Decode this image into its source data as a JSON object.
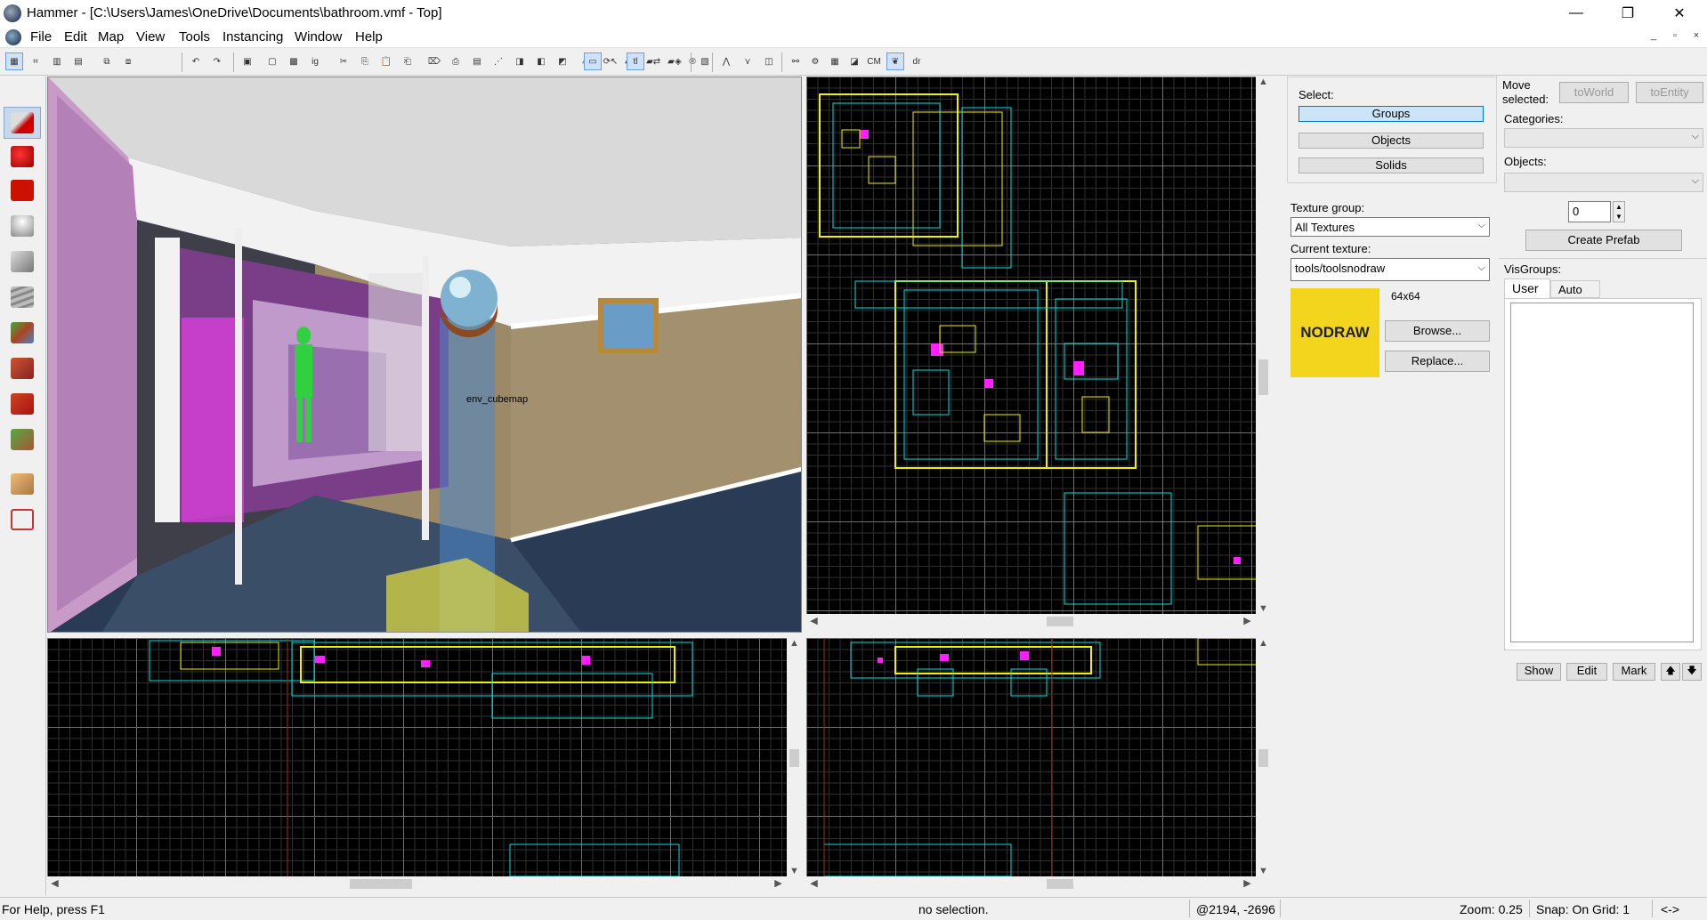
{
  "window": {
    "title": "Hammer - [C:\\Users\\James\\OneDrive\\Documents\\bathroom.vmf - Top]",
    "controls": {
      "minimize": "—",
      "maximize": "❐",
      "close": "✕"
    }
  },
  "menu": {
    "items": [
      "File",
      "Edit",
      "Map",
      "View",
      "Tools",
      "Instancing",
      "Window",
      "Help"
    ],
    "mdi": {
      "minimize": "_",
      "restore": "▫",
      "close": "×"
    }
  },
  "toolbar": {
    "cm_label": "CM"
  },
  "viewport3d": {
    "entity_label": "env_cubemap"
  },
  "select_panel": {
    "label": "Select:",
    "buttons": [
      "Groups",
      "Objects",
      "Solids"
    ],
    "selected": "Groups"
  },
  "texture_panel": {
    "group_label": "Texture group:",
    "group_value": "All Textures",
    "current_label": "Current texture:",
    "current_value": "tools/toolsnodraw",
    "size": "64x64",
    "preview_text": "NODRAW",
    "preview_color": "#f2d51c",
    "browse": "Browse...",
    "replace": "Replace..."
  },
  "prefab_panel": {
    "move_label": "Move selected:",
    "to_world": "toWorld",
    "to_entity": "toEntity",
    "categories_label": "Categories:",
    "objects_label": "Objects:",
    "count": "0",
    "create_prefab": "Create Prefab"
  },
  "visgroups": {
    "label": "VisGroups:",
    "tabs": [
      "User",
      "Auto"
    ],
    "buttons": [
      "Show",
      "Edit",
      "Mark"
    ],
    "up": "🡅",
    "down": "🡇"
  },
  "status": {
    "help": "For Help, press F1",
    "selection": "no selection.",
    "coords": "@2194, -2696",
    "zoom": "Zoom: 0.25",
    "snap": "Snap: On Grid: 1",
    "arrows": "<->"
  },
  "colors": {
    "grid_bg": "#000000",
    "brush_yellow": "#f0f000",
    "brush_cyan": "#00e0e0",
    "brush_magenta": "#ff20ff",
    "selected_button": "#cce4f7"
  }
}
